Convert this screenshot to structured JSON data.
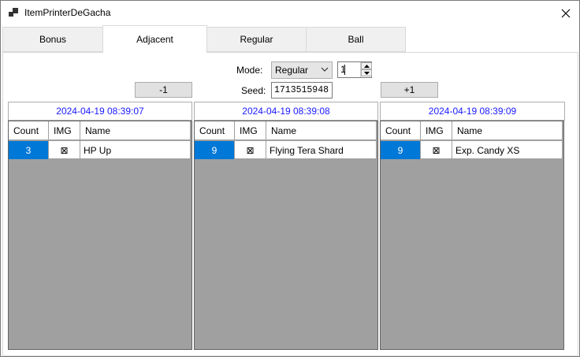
{
  "window": {
    "title": "ItemPrinterDeGacha"
  },
  "tabs": [
    {
      "label": "Bonus",
      "selected": false
    },
    {
      "label": "Adjacent",
      "selected": true
    },
    {
      "label": "Regular",
      "selected": false
    },
    {
      "label": "Ball",
      "selected": false
    }
  ],
  "controls": {
    "mode_label": "Mode:",
    "mode_value": "Regular",
    "count_value": "1",
    "seed_label": "Seed:",
    "seed_value": "1713515948",
    "minus_label": "-1",
    "plus_label": "+1"
  },
  "panels": [
    {
      "timestamp": "2024-04-19 08:39:07",
      "columns": [
        "Count",
        "IMG",
        "Name"
      ],
      "rows": [
        {
          "count": "3",
          "img": "⊠",
          "name": "HP Up"
        }
      ]
    },
    {
      "timestamp": "2024-04-19 08:39:08",
      "columns": [
        "Count",
        "IMG",
        "Name"
      ],
      "rows": [
        {
          "count": "9",
          "img": "⊠",
          "name": "Flying Tera Shard"
        }
      ]
    },
    {
      "timestamp": "2024-04-19 08:39:09",
      "columns": [
        "Count",
        "IMG",
        "Name"
      ],
      "rows": [
        {
          "count": "9",
          "img": "⊠",
          "name": "Exp. Candy XS"
        }
      ]
    }
  ],
  "colors": {
    "selection": "#0078d7",
    "timestamp_text": "#1a1aff",
    "grid_background": "#a0a0a0"
  }
}
